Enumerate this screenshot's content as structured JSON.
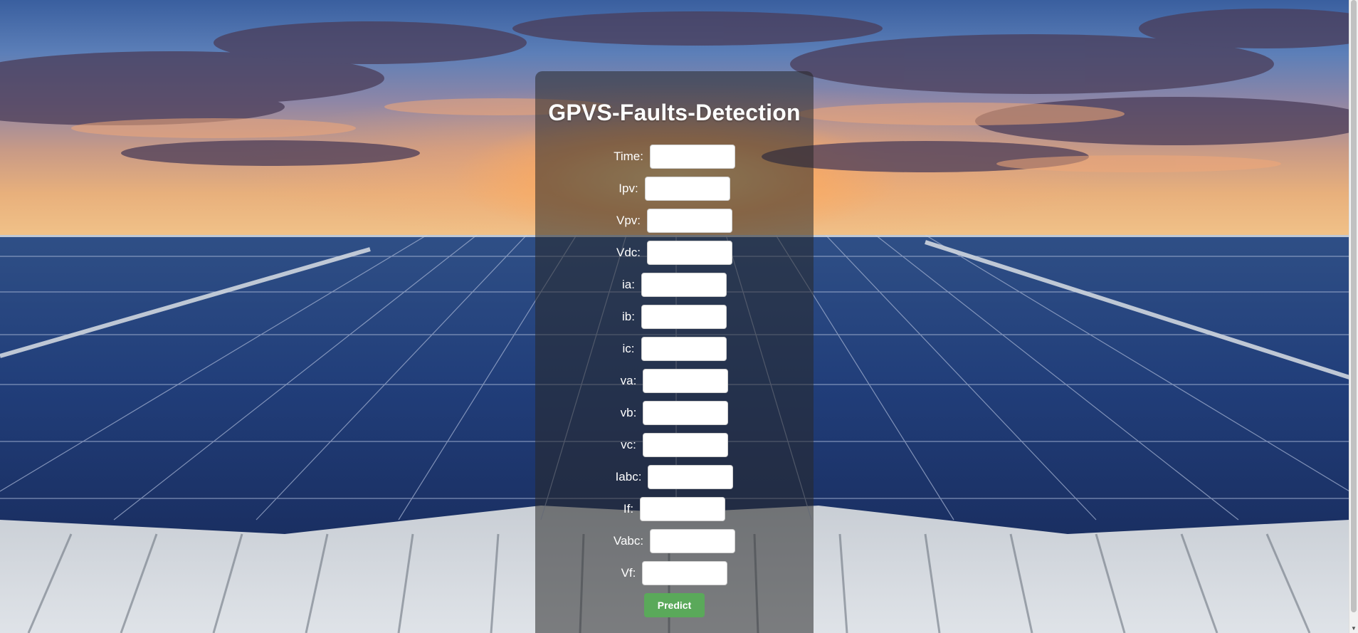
{
  "page": {
    "title": "GPVS-Faults-Detection"
  },
  "form": {
    "fields": [
      {
        "label": "Time:",
        "value": ""
      },
      {
        "label": "Ipv:",
        "value": ""
      },
      {
        "label": "Vpv:",
        "value": ""
      },
      {
        "label": "Vdc:",
        "value": ""
      },
      {
        "label": "ia:",
        "value": ""
      },
      {
        "label": "ib:",
        "value": ""
      },
      {
        "label": "ic:",
        "value": ""
      },
      {
        "label": "va:",
        "value": ""
      },
      {
        "label": "vb:",
        "value": ""
      },
      {
        "label": "vc:",
        "value": ""
      },
      {
        "label": "Iabc:",
        "value": ""
      },
      {
        "label": "If:",
        "value": ""
      },
      {
        "label": "Vabc:",
        "value": ""
      },
      {
        "label": "Vf:",
        "value": ""
      }
    ],
    "submit_label": "Predict"
  },
  "colors": {
    "card_overlay": "#282828",
    "button": "#5aa95a",
    "title_text": "#ffffff"
  },
  "background": {
    "description_icon": "solar-panel-sunset-background"
  }
}
